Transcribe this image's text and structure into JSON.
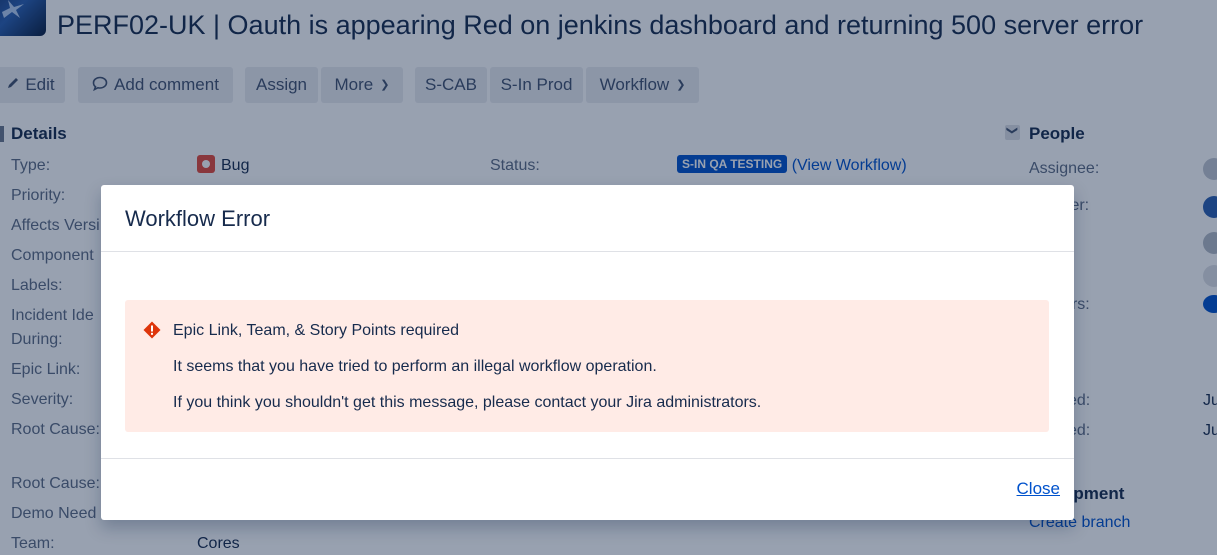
{
  "issue": {
    "title": "PERF02-UK | Oauth is appearing Red on jenkins dashboard and returning 500 server error"
  },
  "toolbar": {
    "edit": "Edit",
    "add_comment": "Add comment",
    "assign": "Assign",
    "more": "More",
    "s_cab": "S-CAB",
    "s_in_prod": "S-In Prod",
    "workflow": "Workflow"
  },
  "details": {
    "heading": "Details",
    "fields": {
      "type_label": "Type:",
      "type_value": "Bug",
      "priority_label": "Priority:",
      "affects_label": "Affects Versi",
      "component_label": "Component",
      "labels_label": "Labels:",
      "incident_label_1": "Incident Ide",
      "incident_label_2": "During:",
      "epic_link_label": "Epic Link:",
      "severity_label": "Severity:",
      "root_cause_label": "Root Cause:",
      "root_cause2_label": "Root Cause:",
      "demo_label": "Demo Need",
      "team_label": "Team:",
      "team_value": "Cores",
      "status_label": "Status:",
      "status_value": "S-IN QA TESTING",
      "view_workflow": "(View Workflow)"
    }
  },
  "people": {
    "heading": "People",
    "assignee_label": "Assignee:",
    "reporter_partial": "ter:",
    "watchers_partial": "ers:",
    "created_partial": "ed:",
    "updated_partial": "ed:",
    "created_value_partial": "Ju",
    "updated_value_partial": "Ju"
  },
  "development": {
    "heading_partial": "opment",
    "create_branch": "Create branch"
  },
  "modal": {
    "title": "Workflow Error",
    "error_heading": "Epic Link, Team, & Story Points required",
    "error_line_1": "It seems that you have tried to perform an illegal workflow operation.",
    "error_line_2": "If you think you shouldn't get this message, please contact your Jira administrators.",
    "close": "Close"
  },
  "colors": {
    "overlay": "#091e42",
    "error_background": "#ffebe6",
    "error_icon": "#de350b",
    "link": "#0052cc",
    "lozenge": "#0052cc"
  }
}
